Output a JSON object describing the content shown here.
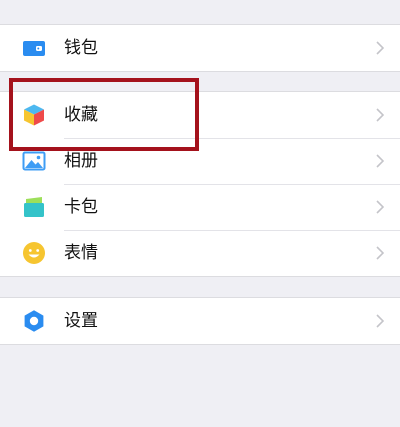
{
  "menu": {
    "wallet_label": "钱包",
    "favorites_label": "收藏",
    "album_label": "相册",
    "cards_label": "卡包",
    "stickers_label": "表情",
    "settings_label": "设置"
  },
  "colors": {
    "page_background": "#efeff4",
    "row_background": "#ffffff",
    "highlight_border": "#a4121c",
    "wallet_icon": "#2a8cf0",
    "album_icon": "#3e9df5",
    "cards_icon": "#34c3c9",
    "stickers_icon": "#f6c530",
    "settings_icon": "#2a8cf0"
  },
  "icons": {
    "wallet": "wallet-icon",
    "favorites": "cube-icon",
    "album": "image-icon",
    "cards": "card-icon",
    "stickers": "smile-icon",
    "settings": "gear-icon",
    "chevron": "chevron-right-icon"
  }
}
